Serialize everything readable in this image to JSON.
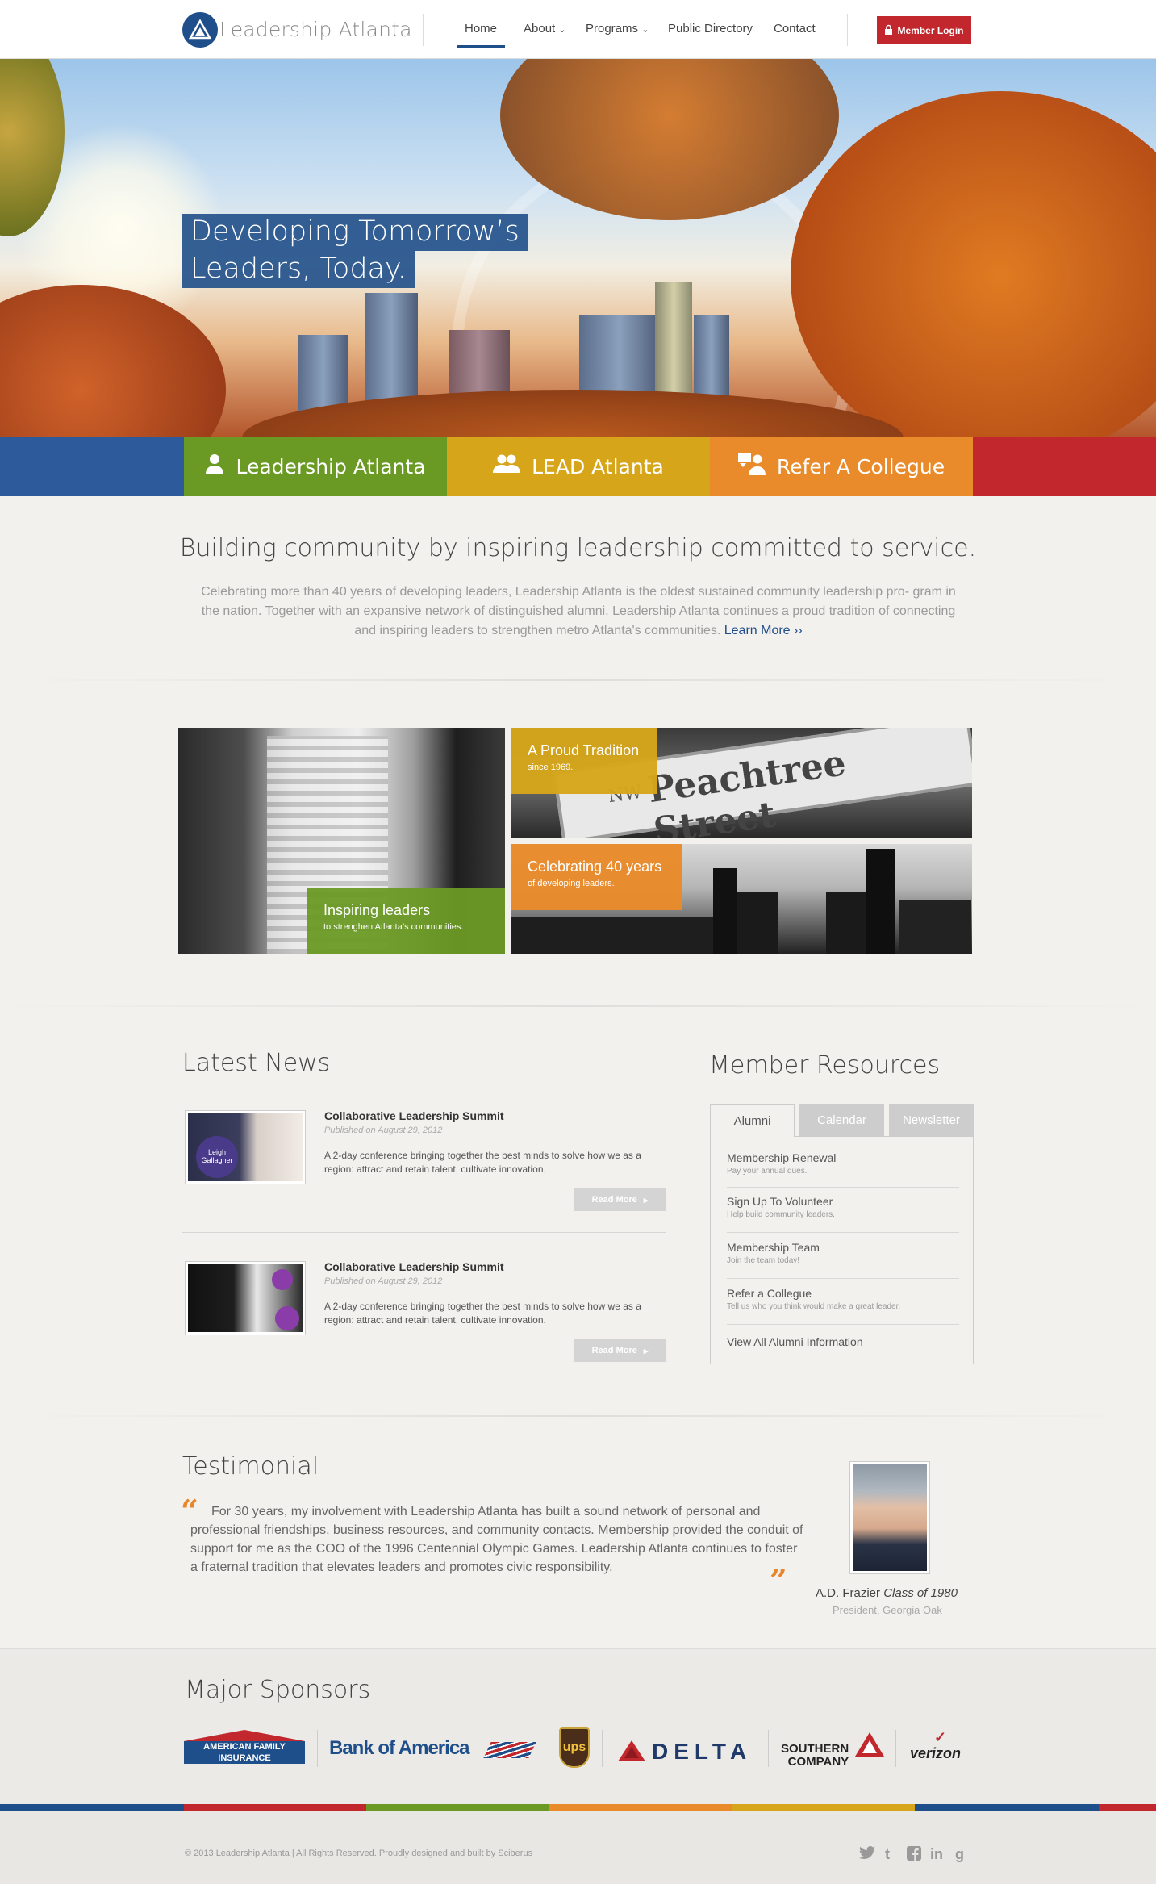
{
  "header": {
    "brand": "Leadership Atlanta",
    "nav": [
      "Home",
      "About",
      "Programs",
      "Public Directory",
      "Contact"
    ],
    "login": "Member Login"
  },
  "hero": {
    "line1": "Developing Tomorrow’s",
    "line2": "Leaders, Today."
  },
  "tabs": [
    "Leadership Atlanta",
    "LEAD Atlanta",
    "Refer A Collegue"
  ],
  "colors": {
    "blue": "#2d5a9b",
    "green": "#6a9a24",
    "yellow": "#d6a51a",
    "orange": "#e98a2b",
    "red": "#c1272d",
    "navy": "#1f4f8a"
  },
  "intro": {
    "title": "Building community by inspiring leadership committed to service.",
    "body": "Celebrating more than 40 years of developing leaders, Leadership Atlanta is the oldest sustained community leadership pro- gram in the nation. Together with an expansive network of distinguished alumni, Leadership Atlanta continues a proud tradition of connecting and inspiring leaders to strengthen metro Atlanta's communities.",
    "link": "Learn More ››"
  },
  "photos": {
    "inspire": {
      "title": "Inspiring leaders",
      "sub": "to strenghen Atlanta’s communities."
    },
    "tradition": {
      "title": "A Proud Tradition",
      "sub": "since 1969."
    },
    "street": "Peachtree Street",
    "street_prefix": "NW",
    "celebrate": {
      "title": "Celebrating 40 years",
      "sub": "of developing leaders."
    }
  },
  "news": {
    "title": "Latest News",
    "items": [
      {
        "headline": "Collaborative Leadership Summit",
        "date": "Published on August 29, 2012",
        "body": "A 2-day conference bringing together the best minds to solve how we as a region: attract and retain talent, cultivate innovation.",
        "btn": "Read More"
      },
      {
        "headline": "Collaborative Leadership Summit",
        "date": "Published on August 29, 2012",
        "body": "A 2-day conference bringing together the best minds to solve how we as a region: attract and retain talent, cultivate innovation.",
        "btn": "Read More"
      }
    ],
    "thumb1_text": "Leigh Gallagher"
  },
  "resources": {
    "title": "Member Resources",
    "tabs": [
      "Alumni",
      "Calendar",
      "Newsletter"
    ],
    "items": [
      {
        "title": "Membership Renewal",
        "sub": "Pay your annual dues."
      },
      {
        "title": "Sign Up To Volunteer",
        "sub": "Help build community leaders."
      },
      {
        "title": "Membership Team",
        "sub": "Join the team today!"
      },
      {
        "title": "Refer a Collegue",
        "sub": "Tell us who you think would make a great leader."
      }
    ],
    "view_all": "View All Alumni Information"
  },
  "testimonial": {
    "title": "Testimonial",
    "quote": "For 30 years, my involvement with Leadership Atlanta has built a sound network of personal and professional friendships, business resources, and community contacts. Membership provided the conduit of support for me as the COO of the 1996 Centennial Olympic Games. Leadership Atlanta continues to foster a fraternal tradition that elevates leaders and promotes civic responsibility.",
    "name": "A.D. Frazier",
    "class": "Class of 1980",
    "role": "President, Georgia Oak"
  },
  "sponsors": {
    "title": "Major Sponsors",
    "amfam1": "AMERICAN FAMILY",
    "amfam2": "INSURANCE",
    "boa": "Bank of America",
    "ups": "ups",
    "delta": "DELTA",
    "southern1": "SOUTHERN",
    "southern2": "COMPANY",
    "verizon": "verizon"
  },
  "footer": {
    "copy": "© 2013 Leadership Atlanta | All Rights Reserved. Proudly designed and built by",
    "link": "Sciberus",
    "social": [
      "twitter-bird-icon",
      "tumblr-icon",
      "facebook-icon",
      "linkedin-icon",
      "google-icon"
    ]
  }
}
